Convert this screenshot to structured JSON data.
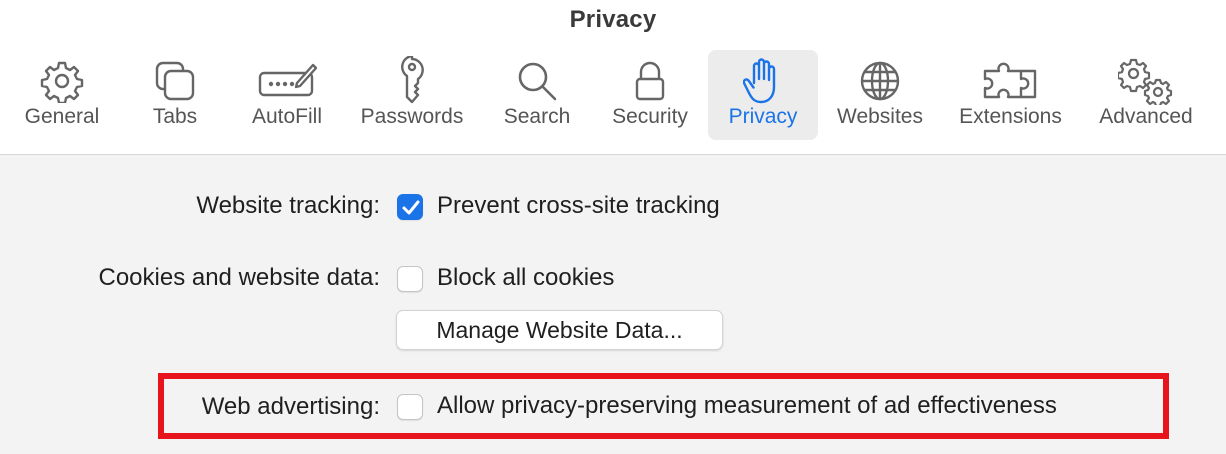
{
  "window": {
    "title": "Privacy"
  },
  "tabs": [
    {
      "label": "General",
      "icon": "gear-icon"
    },
    {
      "label": "Tabs",
      "icon": "tabs-icon"
    },
    {
      "label": "AutoFill",
      "icon": "autofill-icon"
    },
    {
      "label": "Passwords",
      "icon": "key-icon"
    },
    {
      "label": "Search",
      "icon": "search-icon"
    },
    {
      "label": "Security",
      "icon": "lock-icon"
    },
    {
      "label": "Privacy",
      "icon": "hand-icon",
      "active": true
    },
    {
      "label": "Websites",
      "icon": "globe-icon"
    },
    {
      "label": "Extensions",
      "icon": "puzzle-icon"
    },
    {
      "label": "Advanced",
      "icon": "gears-icon"
    }
  ],
  "settings": {
    "website_tracking": {
      "label": "Website tracking:",
      "option": "Prevent cross-site tracking",
      "checked": true
    },
    "cookies": {
      "label": "Cookies and website data:",
      "option": "Block all cookies",
      "checked": false,
      "button": "Manage Website Data..."
    },
    "web_advertising": {
      "label": "Web advertising:",
      "option": "Allow privacy-preserving measurement of ad effectiveness",
      "checked": false
    }
  },
  "colors": {
    "accent": "#1a74e8",
    "highlight": "#e8141b",
    "toolbar_bg": "#ffffff",
    "content_bg": "#f3f3f3"
  }
}
